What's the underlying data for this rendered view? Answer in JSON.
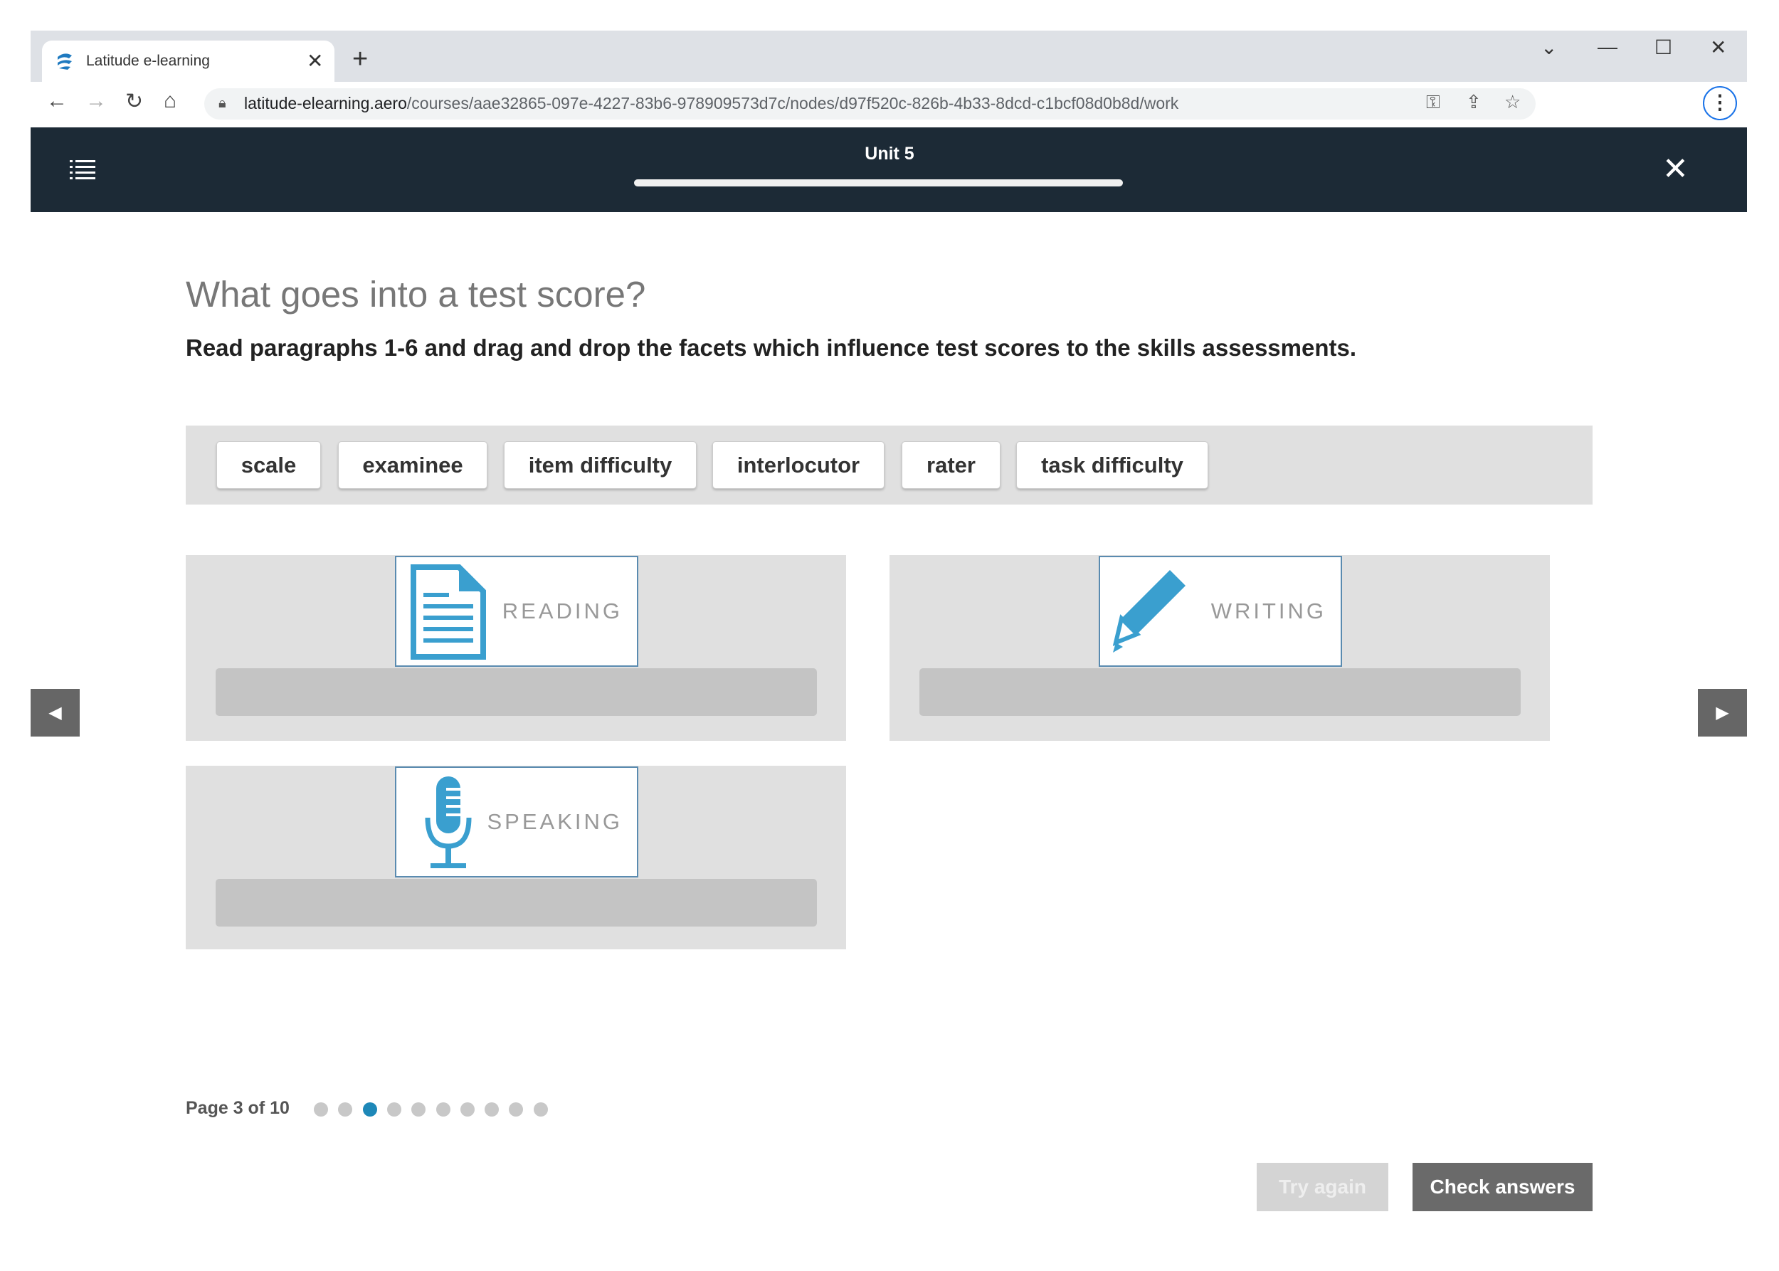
{
  "browser": {
    "tab_title": "Latitude e-learning",
    "url_host": "latitude-elearning.aero",
    "url_path": "/courses/aae32865-097e-4227-83b6-978909573d7c/nodes/d97f520c-826b-4b33-8dcd-c1bcf08d0b8d/work"
  },
  "header": {
    "title": "Unit 5",
    "progress_percent": 100
  },
  "main": {
    "title": "What goes into a test score?",
    "instruction": "Read paragraphs 1-6 and drag and drop the facets which influence test scores to the skills assessments.",
    "chips": [
      "scale",
      "examinee",
      "item difficulty",
      "interlocutor",
      "rater",
      "task difficulty"
    ],
    "zones": [
      {
        "label": "READING",
        "icon": "document-icon"
      },
      {
        "label": "WRITING",
        "icon": "pencil-icon"
      },
      {
        "label": "SPEAKING",
        "icon": "microphone-icon"
      }
    ]
  },
  "pagination": {
    "text": "Page 3 of 10",
    "current": 3,
    "total": 10
  },
  "buttons": {
    "try_again": "Try again",
    "check_answers": "Check answers"
  },
  "colors": {
    "accent": "#3a9fcf",
    "header_bg": "#1c2a36",
    "active_dot": "#1e88b8"
  }
}
